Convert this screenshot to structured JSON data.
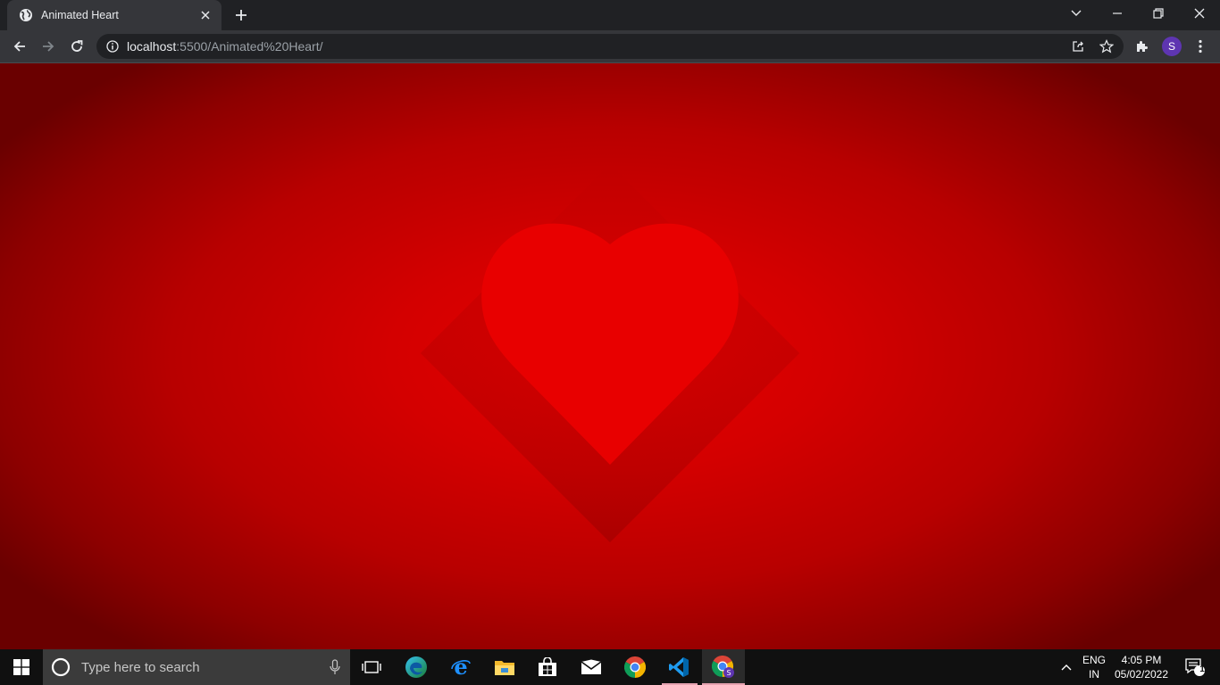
{
  "browser": {
    "tab": {
      "title": "Animated Heart"
    },
    "address": {
      "host": "localhost",
      "rest": ":5500/Animated%20Heart/"
    },
    "profile_initial": "S"
  },
  "page": {
    "colors": {
      "heart": "#e80000",
      "background_center": "#e50000",
      "background_edge": "#6a0000"
    }
  },
  "taskbar": {
    "search_placeholder": "Type here to search",
    "apps": [
      "task-view",
      "edge",
      "internet-explorer",
      "file-explorer",
      "microsoft-store",
      "mail",
      "chrome",
      "vscode",
      "chrome-profile"
    ],
    "language": {
      "line1": "ENG",
      "line2": "IN"
    },
    "clock": {
      "time": "4:05 PM",
      "date": "05/02/2022"
    },
    "notification_count": "1"
  }
}
